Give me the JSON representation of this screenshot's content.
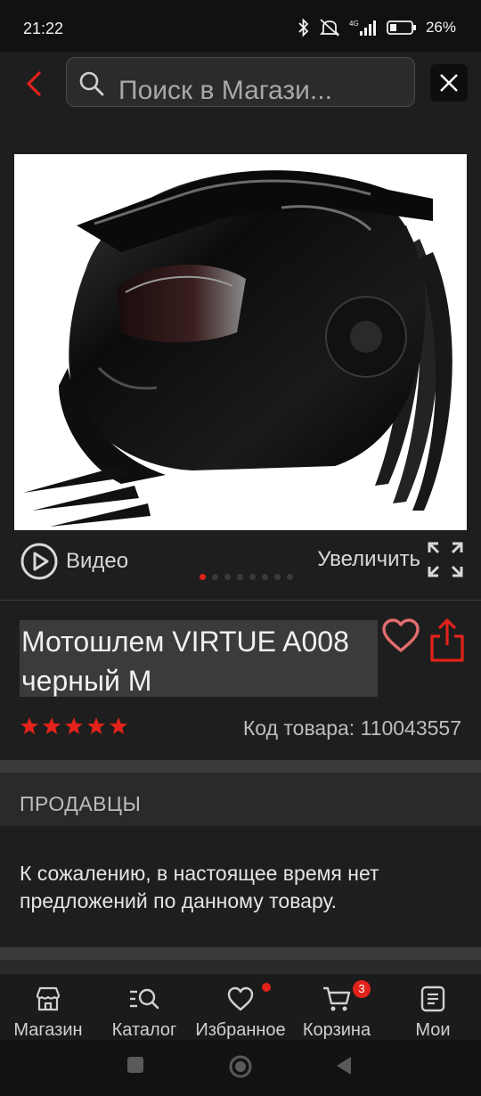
{
  "status_bar": {
    "time": "21:22",
    "network": "4G",
    "battery_percent": "26%",
    "icons": [
      "bluetooth-icon",
      "mute-icon",
      "signal-icon",
      "battery-icon"
    ]
  },
  "header": {
    "search_placeholder": "Поиск в Магази...",
    "icons": [
      "back-icon",
      "search-icon",
      "close-icon"
    ]
  },
  "gallery": {
    "image_count": 8,
    "active_index": 0,
    "video_label": "Видео",
    "zoom_label": "Увеличить"
  },
  "product": {
    "title": "Мотошлем VIRTUE A008 черный М",
    "rating": 5,
    "sku_label": "Код товара: 110043557"
  },
  "sellers": {
    "title": "ПРОДАВЦЫ",
    "message": "К сожалению, в настоящее время нет предложений по данному товару."
  },
  "bottom_nav": {
    "items": [
      {
        "label": "Магазин",
        "icon": "store-icon"
      },
      {
        "label": "Каталог",
        "icon": "catalog-search-icon"
      },
      {
        "label": "Избранное",
        "icon": "heart-icon",
        "has_dot": true
      },
      {
        "label": "Корзина",
        "icon": "cart-icon",
        "badge": "3"
      },
      {
        "label": "Мои",
        "icon": "orders-icon"
      }
    ]
  },
  "colors": {
    "accent": "#e2231a",
    "background": "#1e1e1e",
    "surface": "#2a2a2a"
  }
}
